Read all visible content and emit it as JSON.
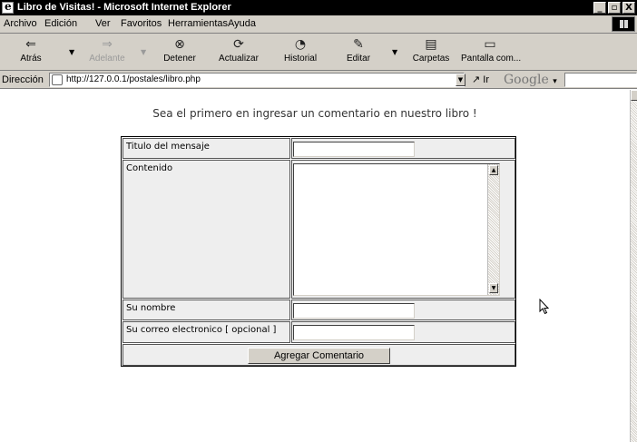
{
  "window": {
    "title": "Libro de Visitas! - Microsoft Internet Explorer",
    "controls": [
      "_",
      "д",
      "X"
    ]
  },
  "menu": [
    "Archivo",
    "Edición",
    "Ver",
    "Favoritos",
    "Herramientas",
    "Ayuda"
  ],
  "toolbar": {
    "back": "Atrás",
    "forward": "Adelante",
    "stop": "Detener",
    "refresh": "Actualizar",
    "history": "Historial",
    "edit": "Editar",
    "folders": "Carpetas",
    "fullscreen": "Pantalla com..."
  },
  "address": {
    "label": "Dirección",
    "url": "http://127.0.0.1/postales/libro.php",
    "go": "Ir",
    "search_brand": "Google"
  },
  "page": {
    "intro": "Sea el primero en ingresar un comentario en nuestro libro !",
    "form": {
      "title_label": "Titulo del mensaje",
      "content_label": "Contenido",
      "name_label": "Su nombre",
      "email_label": "Su correo electronico [ opcional ]",
      "title_value": "",
      "content_value": "",
      "name_value": "",
      "email_value": "",
      "submit": "Agregar Comentario"
    }
  },
  "colors": {
    "chrome": "#d4d0c8",
    "titlebar": "#000000",
    "form_cell": "#eeeeee"
  }
}
